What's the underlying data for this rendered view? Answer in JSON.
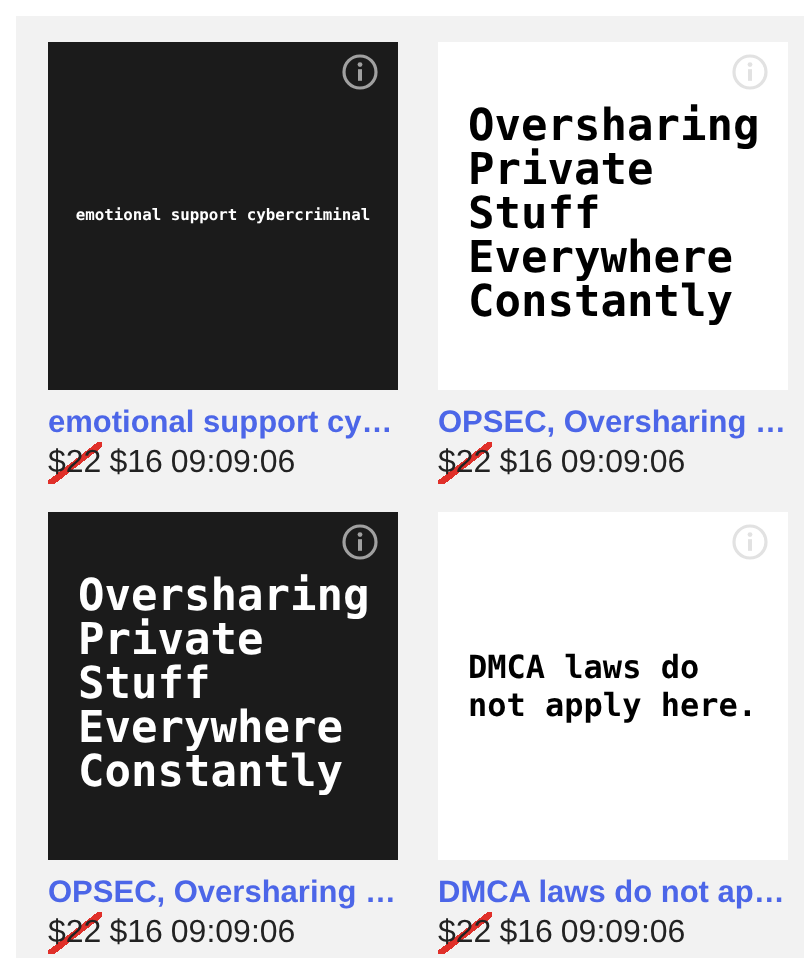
{
  "products": [
    {
      "image": {
        "dark": true,
        "kind": "caption",
        "text": "emotional support cybercriminal"
      },
      "title": "emotional support cy…",
      "old_price": "$22",
      "price": "$16",
      "timer": "09:09:06"
    },
    {
      "image": {
        "dark": false,
        "kind": "poster",
        "text": "Oversharing\nPrivate\nStuff\nEverywhere\nConstantly"
      },
      "title": "OPSEC, Oversharing …",
      "old_price": "$22",
      "price": "$16",
      "timer": "09:09:06"
    },
    {
      "image": {
        "dark": true,
        "kind": "poster",
        "text": "Oversharing\nPrivate\nStuff\nEverywhere\nConstantly"
      },
      "title": "OPSEC, Oversharing …",
      "old_price": "$22",
      "price": "$16",
      "timer": "09:09:06"
    },
    {
      "image": {
        "dark": false,
        "kind": "note",
        "text": "DMCA laws do\nnot apply here."
      },
      "title": "DMCA laws do not ap…",
      "old_price": "$22",
      "price": "$16",
      "timer": "09:09:06"
    }
  ]
}
